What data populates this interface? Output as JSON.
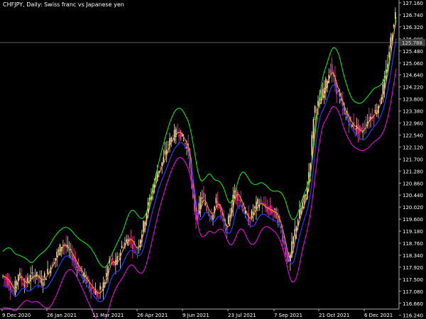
{
  "chart_header": {
    "symbol": "CHFJPY,",
    "timeframe": "Daily:",
    "description": "Swiss franc vs Japanese yen"
  },
  "price_scale": {
    "ticks": [
      "127.160",
      "126.740",
      "126.320",
      "125.900",
      "125.480",
      "125.060",
      "124.640",
      "124.220",
      "123.800",
      "123.380",
      "122.960",
      "122.540",
      "122.120",
      "121.700",
      "121.280",
      "120.860",
      "120.440",
      "120.020",
      "119.600",
      "119.180",
      "118.760",
      "118.340",
      "117.920",
      "117.500",
      "117.080",
      "116.660",
      "116.240"
    ],
    "current_price": "125.788"
  },
  "time_scale": {
    "ticks": [
      "9 Dec 2020",
      "26 Jan 2021",
      "11 Mar 2021",
      "26 Apr 2021",
      "9 Jun 2021",
      "23 Jul 2021",
      "7 Sep 2021",
      "21 Oct 2021",
      "6 Dec 2021"
    ]
  },
  "colors": {
    "background": "#000000",
    "bull_candle": "#f5deb3",
    "bear_candle": "#ff3aa8",
    "upper_band": "#00ff00",
    "lower_band": "#ff00ff",
    "mid_line": "#ffa500",
    "trend_line": "#2040ff",
    "axis_text": "#ffffff",
    "price_line": "#808080"
  },
  "chart_data": {
    "type": "candlestick",
    "x_range": [
      "9 Dec 2020",
      "Dec 2021"
    ],
    "ylim": [
      116.0,
      127.25
    ],
    "grid": false,
    "close_series": [
      [
        0,
        117.2
      ],
      [
        8,
        117.0
      ],
      [
        15,
        116.6
      ],
      [
        22,
        117.3
      ],
      [
        30,
        116.9
      ],
      [
        38,
        117.1
      ],
      [
        45,
        117.3
      ],
      [
        55,
        117.0
      ],
      [
        65,
        117.4
      ],
      [
        75,
        117.9
      ],
      [
        85,
        118.4
      ],
      [
        95,
        118.1
      ],
      [
        105,
        117.6
      ],
      [
        115,
        117.2
      ],
      [
        125,
        116.8
      ],
      [
        135,
        116.5
      ],
      [
        145,
        117.0
      ],
      [
        152,
        117.8
      ],
      [
        160,
        117.6
      ],
      [
        170,
        118.3
      ],
      [
        180,
        118.6
      ],
      [
        190,
        118.1
      ],
      [
        198,
        118.8
      ],
      [
        205,
        119.6
      ],
      [
        212,
        120.3
      ],
      [
        220,
        121.0
      ],
      [
        228,
        121.4
      ],
      [
        235,
        122.0
      ],
      [
        242,
        122.3
      ],
      [
        250,
        122.5
      ],
      [
        258,
        122.1
      ],
      [
        265,
        121.7
      ],
      [
        270,
        120.0
      ],
      [
        276,
        119.2
      ],
      [
        283,
        120.2
      ],
      [
        290,
        119.6
      ],
      [
        297,
        119.4
      ],
      [
        305,
        120.0
      ],
      [
        312,
        119.3
      ],
      [
        318,
        118.8
      ],
      [
        324,
        119.6
      ],
      [
        330,
        120.3
      ],
      [
        337,
        120.0
      ],
      [
        344,
        119.5
      ],
      [
        350,
        119.2
      ],
      [
        357,
        119.6
      ],
      [
        364,
        119.9
      ],
      [
        372,
        119.7
      ],
      [
        380,
        119.6
      ],
      [
        388,
        119.5
      ],
      [
        395,
        119.0
      ],
      [
        400,
        118.4
      ],
      [
        404,
        117.9
      ],
      [
        408,
        117.7
      ],
      [
        412,
        118.4
      ],
      [
        418,
        119.1
      ],
      [
        425,
        119.7
      ],
      [
        432,
        120.2
      ],
      [
        438,
        121.5
      ],
      [
        443,
        123.3
      ],
      [
        450,
        123.5
      ],
      [
        456,
        123.9
      ],
      [
        462,
        124.4
      ],
      [
        467,
        124.8
      ],
      [
        472,
        124.2
      ],
      [
        478,
        123.8
      ],
      [
        484,
        123.3
      ],
      [
        490,
        123.0
      ],
      [
        496,
        122.7
      ],
      [
        503,
        122.6
      ],
      [
        510,
        122.4
      ],
      [
        517,
        122.8
      ],
      [
        524,
        123.0
      ],
      [
        531,
        123.2
      ],
      [
        538,
        123.7
      ],
      [
        545,
        124.5
      ],
      [
        551,
        125.6
      ],
      [
        556,
        126.4
      ],
      [
        560,
        126.9
      ]
    ],
    "indicators": [
      "upper band",
      "middle line",
      "trend line",
      "lower band"
    ]
  }
}
